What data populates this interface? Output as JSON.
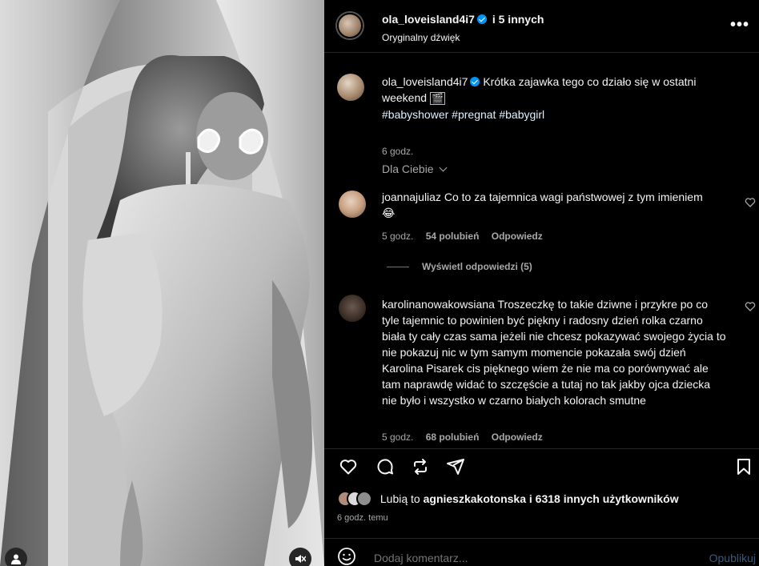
{
  "header": {
    "author": "ola_loveisland4i7",
    "coauthors": "i 5 innych",
    "audio": "Oryginalny dźwięk",
    "more_icon": "more-horizontal-icon"
  },
  "caption": {
    "username": "ola_loveisland4i7",
    "text": "Krótka zajawka tego co działo się w ostatni weekend",
    "emoji_box": "🎬",
    "hashtags": [
      "#babyshower",
      "#pregnat",
      "#babygirl"
    ],
    "time": "6 godz."
  },
  "filter": {
    "label": "Dla Ciebie"
  },
  "comments": [
    {
      "username": "joannajuliaz",
      "text": "Co to za tajemnica wagi państwowej z tym imieniem",
      "emoji": "😂",
      "time": "5 godz.",
      "likes": "54 polubień",
      "reply": "Odpowiedz",
      "view_replies": "Wyświetl odpowiedzi (5)"
    },
    {
      "username": "karolinanowakowsiana",
      "text": "Troszeczkę to takie dziwne i przykre po co tyle tajemnic to powinien być piękny i radosny dzień rolka czarno biała ty cały czas sama jeżeli nie chcesz pokazywać swojego życia to nie pokazuj nic w tym samym momencie pokazała swój dzień Karolina Pisarek cis pięknego wiem że nie ma co porównywać ale tam naprawdę widać to szczęście a tutaj no tak jakby ojca dziecka nie było i wszystko w czarno białych kolorach smutne",
      "time": "5 godz.",
      "likes": "68 polubień",
      "reply": "Odpowiedz"
    }
  ],
  "likes": {
    "prefix": "Lubią to",
    "user": "agnieszkakotonska",
    "rest": "i 6318 innych użytkowników"
  },
  "posted": "6 godz. temu",
  "composer": {
    "placeholder": "Dodaj komentarz...",
    "publish": "Opublikuj"
  },
  "colors": {
    "background": "#000000",
    "text": "#f5f5f5",
    "muted": "#a8a8a8",
    "verified": "#0095f6",
    "hashtag": "#e0f1ff",
    "divider": "#262626"
  }
}
